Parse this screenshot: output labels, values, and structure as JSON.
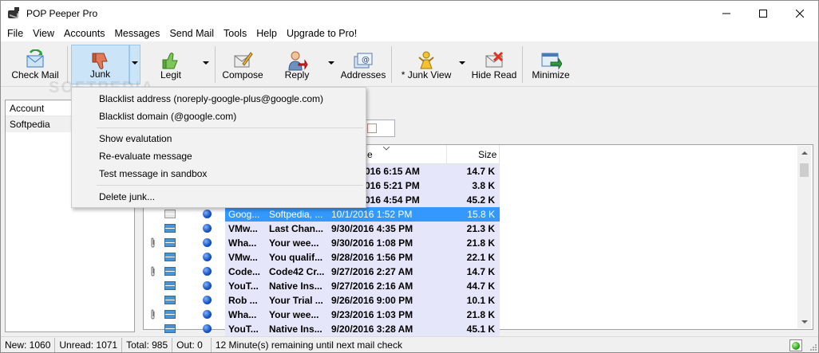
{
  "window": {
    "title": "POP Peeper Pro"
  },
  "menubar": {
    "items": [
      "File",
      "View",
      "Accounts",
      "Messages",
      "Send Mail",
      "Tools",
      "Help",
      "Upgrade to Pro!"
    ]
  },
  "toolbar": {
    "check_mail": "Check Mail",
    "junk": "Junk",
    "legit": "Legit",
    "compose": "Compose",
    "reply": "Reply",
    "addresses": "Addresses",
    "junk_view": "* Junk View",
    "hide_read": "Hide Read",
    "minimize": "Minimize"
  },
  "watermark": "SOFTPEDIA",
  "accounts": {
    "header": "Account",
    "items": [
      "Softpedia"
    ]
  },
  "junk_menu": {
    "items": [
      "Blacklist address (noreply-google-plus@google.com)",
      "Blacklist domain (@google.com)",
      "Show evalutation",
      "Re-evaluate message",
      "Test message in sandbox",
      "Delete junk..."
    ]
  },
  "message_list": {
    "col_date_tail": "e",
    "col_size": "Size",
    "rows": [
      {
        "from": "",
        "subject": "",
        "date": "016 6:15 AM",
        "size": "14.7 K",
        "unread": true,
        "attachment": false
      },
      {
        "from": "",
        "subject": "",
        "date": "016 5:21 PM",
        "size": "3.8 K",
        "unread": true,
        "attachment": false
      },
      {
        "from": "",
        "subject": "",
        "date": "016 4:54 PM",
        "size": "45.2 K",
        "unread": true,
        "attachment": false
      },
      {
        "from": "Goog...",
        "subject": "Softpedia, ...",
        "date": "10/1/2016 1:52 PM",
        "size": "15.8 K",
        "unread": false,
        "attachment": false,
        "selected": true
      },
      {
        "from": "VMw...",
        "subject": "Last Chan...",
        "date": "9/30/2016 4:35 PM",
        "size": "21.3 K",
        "unread": true,
        "attachment": false
      },
      {
        "from": "Wha...",
        "subject": "Your wee...",
        "date": "9/30/2016 1:08 PM",
        "size": "21.8 K",
        "unread": true,
        "attachment": true
      },
      {
        "from": "VMw...",
        "subject": "You qualif...",
        "date": "9/28/2016 1:56 PM",
        "size": "22.1 K",
        "unread": true,
        "attachment": false
      },
      {
        "from": "Code...",
        "subject": "Code42 Cr...",
        "date": "9/27/2016 2:27 AM",
        "size": "14.7 K",
        "unread": true,
        "attachment": true
      },
      {
        "from": "YouT...",
        "subject": "Native Ins...",
        "date": "9/27/2016 2:16 AM",
        "size": "44.7 K",
        "unread": true,
        "attachment": false
      },
      {
        "from": "Rob ...",
        "subject": "Your Trial ...",
        "date": "9/26/2016 9:00 PM",
        "size": "10.1 K",
        "unread": true,
        "attachment": false
      },
      {
        "from": "Wha...",
        "subject": "Your wee...",
        "date": "9/23/2016 1:03 PM",
        "size": "21.8 K",
        "unread": true,
        "attachment": true
      },
      {
        "from": "YouT...",
        "subject": "Native Ins...",
        "date": "9/20/2016 3:28 AM",
        "size": "45.1 K",
        "unread": true,
        "attachment": false
      }
    ]
  },
  "statusbar": {
    "new": "New: 1060",
    "unread": "Unread: 1071",
    "total": "Total: 985",
    "out": "Out: 0",
    "next_check": "12 Minute(s) remaining until next mail check"
  },
  "colors": {
    "selection": "#3399ff",
    "highlight": "#cce4f7",
    "row_tint": "#e6e6fa"
  }
}
